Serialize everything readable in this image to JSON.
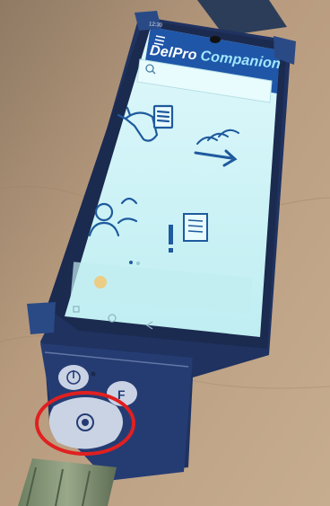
{
  "app": {
    "product": "DelPro",
    "product_suffix": "Companion",
    "status_time": "12:30"
  },
  "home": {
    "tiles": [
      {
        "icon": "cow-task-icon"
      },
      {
        "icon": "herd-move-icon"
      },
      {
        "icon": "people-icon"
      },
      {
        "icon": "alert-list-icon"
      }
    ],
    "page_dots": 2,
    "active_dot": 1
  },
  "colors": {
    "screen": "#c9f0f4",
    "app_bar": "#1f56a8",
    "device_body": "#23386b",
    "keypad_ring": "#e02020",
    "floor": "#b4977a"
  }
}
